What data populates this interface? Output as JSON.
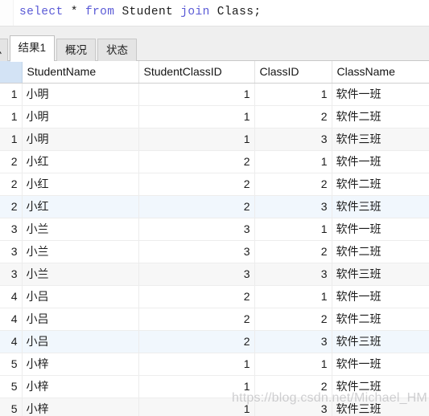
{
  "editor": {
    "sql_tokens": [
      {
        "text": "select",
        "kind": "keyword"
      },
      {
        "text": " ",
        "kind": "space"
      },
      {
        "text": "*",
        "kind": "operator"
      },
      {
        "text": " ",
        "kind": "space"
      },
      {
        "text": "from",
        "kind": "keyword"
      },
      {
        "text": " ",
        "kind": "space"
      },
      {
        "text": "Student",
        "kind": "identifier"
      },
      {
        "text": " ",
        "kind": "space"
      },
      {
        "text": "join",
        "kind": "keyword"
      },
      {
        "text": " ",
        "kind": "space"
      },
      {
        "text": "Class",
        "kind": "identifier"
      },
      {
        "text": ";",
        "kind": "punctuation"
      }
    ],
    "sql_text": "select * from Student join Class;",
    "keyword_color": "#5a5ad6",
    "identifier_color": "#1c1c1c"
  },
  "tabs": {
    "items": [
      {
        "label": "息",
        "active": false,
        "clipped": true
      },
      {
        "label": "结果1",
        "active": true,
        "clipped": false
      },
      {
        "label": "概况",
        "active": false,
        "clipped": false
      },
      {
        "label": "状态",
        "active": false,
        "clipped": false
      }
    ]
  },
  "table": {
    "headers": [
      "",
      "StudentName",
      "StudentClassID",
      "ClassID",
      "ClassName"
    ],
    "header_id_selected_color": "#d3e3f5",
    "rows": [
      {
        "id": "1",
        "name": "小明",
        "student_class_id": "1",
        "class_id": "1",
        "class_name": "软件一班",
        "style": "plain"
      },
      {
        "id": "1",
        "name": "小明",
        "student_class_id": "1",
        "class_id": "2",
        "class_name": "软件二班",
        "style": "plain"
      },
      {
        "id": "1",
        "name": "小明",
        "student_class_id": "1",
        "class_id": "3",
        "class_name": "软件三班",
        "style": "zebra"
      },
      {
        "id": "2",
        "name": "小红",
        "student_class_id": "2",
        "class_id": "1",
        "class_name": "软件一班",
        "style": "plain"
      },
      {
        "id": "2",
        "name": "小红",
        "student_class_id": "2",
        "class_id": "2",
        "class_name": "软件二班",
        "style": "plain"
      },
      {
        "id": "2",
        "name": "小红",
        "student_class_id": "2",
        "class_id": "3",
        "class_name": "软件三班",
        "style": "sel"
      },
      {
        "id": "3",
        "name": "小兰",
        "student_class_id": "3",
        "class_id": "1",
        "class_name": "软件一班",
        "style": "plain"
      },
      {
        "id": "3",
        "name": "小兰",
        "student_class_id": "3",
        "class_id": "2",
        "class_name": "软件二班",
        "style": "plain"
      },
      {
        "id": "3",
        "name": "小兰",
        "student_class_id": "3",
        "class_id": "3",
        "class_name": "软件三班",
        "style": "zebra"
      },
      {
        "id": "4",
        "name": "小吕",
        "student_class_id": "2",
        "class_id": "1",
        "class_name": "软件一班",
        "style": "plain"
      },
      {
        "id": "4",
        "name": "小吕",
        "student_class_id": "2",
        "class_id": "2",
        "class_name": "软件二班",
        "style": "plain"
      },
      {
        "id": "4",
        "name": "小吕",
        "student_class_id": "2",
        "class_id": "3",
        "class_name": "软件三班",
        "style": "sel"
      },
      {
        "id": "5",
        "name": "小梓",
        "student_class_id": "1",
        "class_id": "1",
        "class_name": "软件一班",
        "style": "plain"
      },
      {
        "id": "5",
        "name": "小梓",
        "student_class_id": "1",
        "class_id": "2",
        "class_name": "软件二班",
        "style": "plain"
      },
      {
        "id": "5",
        "name": "小梓",
        "student_class_id": "1",
        "class_id": "3",
        "class_name": "软件三班",
        "style": "zebra"
      }
    ]
  },
  "watermark": {
    "text": "https://blog.csdn.net/Michael_HM"
  }
}
